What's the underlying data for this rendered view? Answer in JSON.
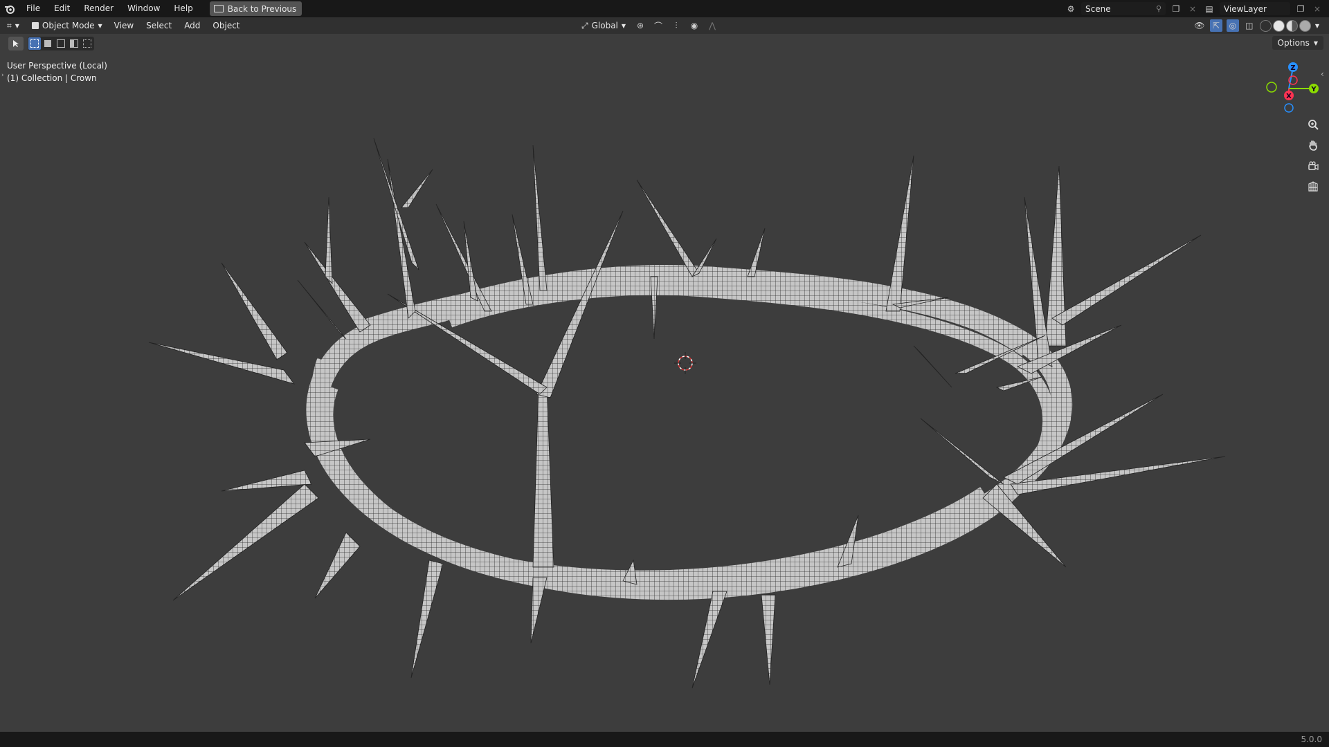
{
  "topbar": {
    "menus": [
      "File",
      "Edit",
      "Render",
      "Window",
      "Help"
    ],
    "back_button": "Back to Previous",
    "scene_label": "Scene",
    "view_layer_label": "ViewLayer"
  },
  "header": {
    "mode": "Object Mode",
    "menus": [
      "View",
      "Select",
      "Add",
      "Object"
    ],
    "transform_orientation": "Global",
    "options_label": "Options"
  },
  "viewport": {
    "perspective_label": "User Perspective (Local)",
    "collection_label": "(1) Collection | Crown"
  },
  "gizmo": {
    "z_label": "Z",
    "y_label": "Y",
    "x_label": "X",
    "colors": {
      "x": "#ff3352",
      "y": "#8bdc00",
      "z": "#2890ff"
    }
  },
  "status": {
    "version": "5.0.0"
  },
  "colors": {
    "viewport_bg": "#3d3d3d",
    "topbar_bg": "#181818",
    "header_bg": "#303030",
    "accent": "#4772b3",
    "mesh_fill": "#c8c8c8",
    "mesh_wire": "#2a2a2a"
  }
}
